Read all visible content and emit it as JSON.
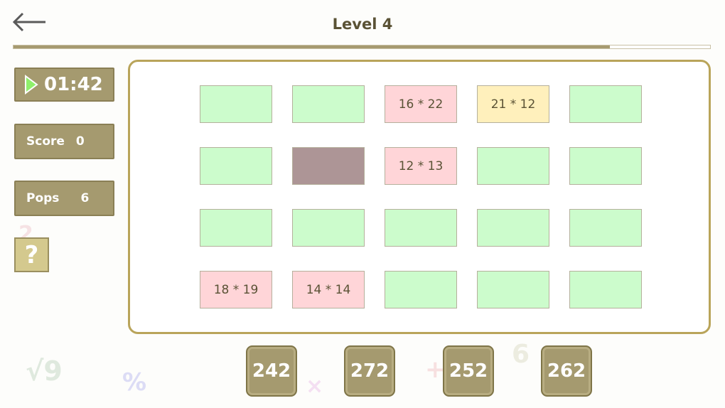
{
  "header": {
    "title": "Level 4",
    "progress": 0.856
  },
  "sidebar": {
    "timer": "01:42",
    "score_label": "Score",
    "score_value": "0",
    "pops_label": "Pops",
    "pops_value": "6",
    "help_label": "?"
  },
  "board": {
    "rows": [
      [
        {
          "label": "",
          "state": "green"
        },
        {
          "label": "",
          "state": "green"
        },
        {
          "label": "16 * 22",
          "state": "pink"
        },
        {
          "label": "21 * 12",
          "state": "yellow"
        },
        {
          "label": "",
          "state": "green"
        }
      ],
      [
        {
          "label": "",
          "state": "green"
        },
        {
          "label": "",
          "state": "brown"
        },
        {
          "label": "12 * 13",
          "state": "pink"
        },
        {
          "label": "",
          "state": "green"
        },
        {
          "label": "",
          "state": "green"
        }
      ],
      [
        {
          "label": "",
          "state": "green"
        },
        {
          "label": "",
          "state": "green"
        },
        {
          "label": "",
          "state": "green"
        },
        {
          "label": "",
          "state": "green"
        },
        {
          "label": "",
          "state": "green"
        }
      ],
      [
        {
          "label": "18 * 19",
          "state": "pink"
        },
        {
          "label": "14 * 14",
          "state": "pink"
        },
        {
          "label": "",
          "state": "green"
        },
        {
          "label": "",
          "state": "green"
        },
        {
          "label": "",
          "state": "green"
        }
      ]
    ]
  },
  "answers": [
    "242",
    "272",
    "252",
    "262"
  ],
  "decorations": [
    {
      "text": "√9",
      "color": "#dfe9de"
    },
    {
      "text": "%",
      "color": "#dcdcf5"
    },
    {
      "text": "×",
      "color": "#f4dff2"
    },
    {
      "text": "+",
      "color": "#f7e0e0"
    },
    {
      "text": "6",
      "color": "#ecece0"
    },
    {
      "text": "2",
      "color": "#f6e2e4"
    }
  ],
  "colors": {
    "accent": "#a59a6f",
    "board_border": "#b9a45a",
    "tile_green": "#ccfccc",
    "tile_pink": "#ffd5d8",
    "tile_yellow": "#fff0bc",
    "tile_brown": "#ad9596"
  },
  "icons": {
    "back": "arrow-left-icon",
    "timer": "play-icon"
  }
}
